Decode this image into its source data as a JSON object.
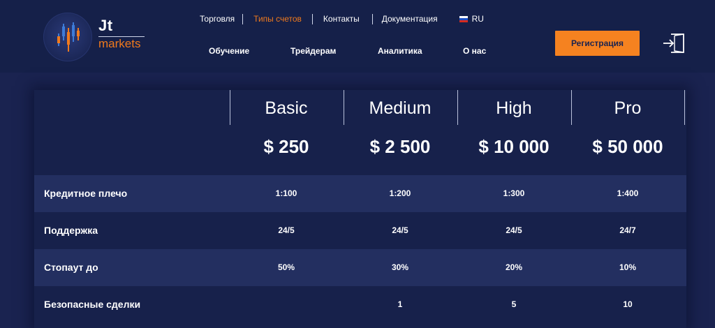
{
  "brand": {
    "name": "Jt",
    "subname": "markets"
  },
  "topnav": [
    {
      "label": "Торговля",
      "active": false
    },
    {
      "label": "Типы счетов",
      "active": true
    },
    {
      "label": "Контакты",
      "active": false
    },
    {
      "label": "Документация",
      "active": false
    }
  ],
  "language": {
    "label": "RU",
    "flag_icon": "russia-flag-icon"
  },
  "mainnav": [
    "Обучение",
    "Трейдерам",
    "Аналитика",
    "О нас"
  ],
  "register_label": "Регистрация",
  "login_icon": "login-icon",
  "colors": {
    "accent": "#f58220",
    "background": "#1a2350",
    "row_alt": "#232f60"
  },
  "plans": [
    {
      "name": "Basic",
      "price": "$ 250"
    },
    {
      "name": "Medium",
      "price": "$ 2 500"
    },
    {
      "name": "High",
      "price": "$ 10 000"
    },
    {
      "name": "Pro",
      "price": "$ 50 000"
    }
  ],
  "rows": [
    {
      "label": "Кредитное плечо",
      "values": [
        "1:100",
        "1:200",
        "1:300",
        "1:400"
      ]
    },
    {
      "label": "Поддержка",
      "values": [
        "24/5",
        "24/5",
        "24/5",
        "24/7"
      ]
    },
    {
      "label": "Стопаут до",
      "values": [
        "50%",
        "30%",
        "20%",
        "10%"
      ]
    },
    {
      "label": "Безопасные сделки",
      "values": [
        "",
        "1",
        "5",
        "10"
      ]
    }
  ]
}
